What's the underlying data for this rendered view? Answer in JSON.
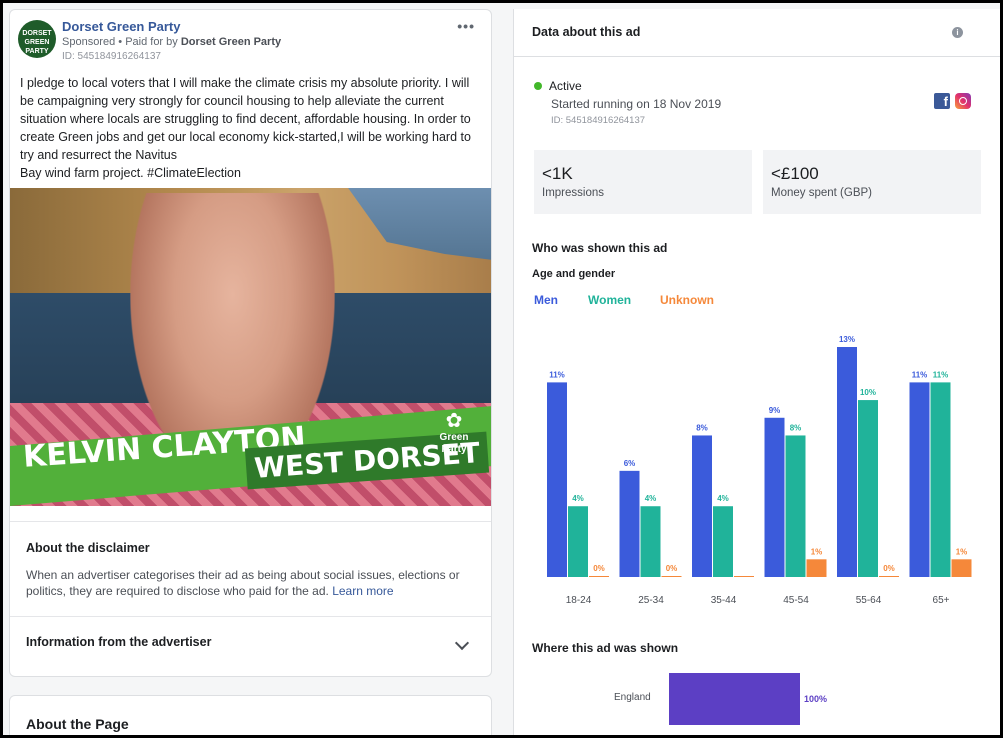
{
  "ad": {
    "page_name": "Dorset Green Party",
    "avatar_text": "DORSET GREEN PARTY",
    "sponsored": "Sponsored",
    "paid_for_prefix": "• Paid for by",
    "paid_for_by": "Dorset Green Party",
    "id": "ID: 545184916264137",
    "more": "•••",
    "body": "I pledge to local voters that I will make the climate crisis my absolute priority. I will be campaigning very strongly for council housing to help alleviate the current situation where locals are struggling to find decent, affordable housing. In order to create Green jobs and get our local economy kick-started,I will be working hard to try and resurrect the Navitus",
    "body_line2": "Bay wind farm project. #ClimateElection",
    "image": {
      "banner_name": "KELVIN CLAYTON",
      "banner_region": "WEST DORSET",
      "logo_line1": "Green",
      "logo_line2": "Party"
    }
  },
  "disclaimer": {
    "title": "About the disclaimer",
    "text": "When an advertiser categorises their ad as being about social issues, elections or politics, they are required to disclose who paid for the ad.",
    "link": "Learn more"
  },
  "advertiser_info": {
    "title": "Information from the advertiser"
  },
  "about_page": {
    "title": "About the Page"
  },
  "panel": {
    "title": "Data about this ad",
    "status": "Active",
    "started": "Started running on 18 Nov 2019",
    "id": "ID: 545184916264137",
    "impressions_value": "<1K",
    "impressions_label": "Impressions",
    "spent_value": "<£100",
    "spent_label": "Money spent (GBP)",
    "who_title": "Who was shown this ad",
    "age_gender_title": "Age and gender",
    "where_title": "Where this ad was shown"
  },
  "colors": {
    "men": "#3b5bdb",
    "women": "#20b39a",
    "unknown": "#f5883a",
    "region": "#5c3fc4"
  },
  "chart_data": [
    {
      "type": "bar",
      "categories": [
        "18-24",
        "25-34",
        "35-44",
        "45-54",
        "55-64",
        "65+"
      ],
      "series": [
        {
          "name": "Men",
          "values": [
            11,
            6,
            8,
            9,
            13,
            11
          ],
          "labels": [
            "11%",
            "6%",
            "8%",
            "9%",
            "13%",
            "11%"
          ]
        },
        {
          "name": "Women",
          "values": [
            4,
            4,
            4,
            8,
            10,
            11
          ],
          "labels": [
            "4%",
            "4%",
            "4%",
            "8%",
            "10%",
            "11%"
          ]
        },
        {
          "name": "Unknown",
          "values": [
            0,
            0,
            0,
            1,
            0,
            1
          ],
          "labels": [
            "0%",
            "0%",
            "",
            "1%",
            "0%",
            "1%"
          ]
        }
      ],
      "ylim": [
        0,
        13
      ]
    },
    {
      "type": "bar",
      "orientation": "horizontal",
      "categories": [
        "England"
      ],
      "values": [
        100
      ],
      "labels": [
        "100%"
      ]
    }
  ]
}
